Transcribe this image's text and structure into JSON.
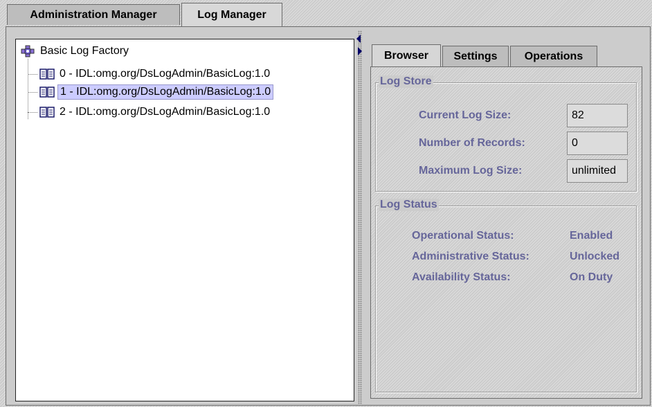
{
  "top_tabs": [
    {
      "label": "Administration Manager",
      "active": false
    },
    {
      "label": "Log Manager",
      "active": true
    }
  ],
  "tree": {
    "root": {
      "label": "Basic Log Factory",
      "icon": "log-factory-icon"
    },
    "items": [
      {
        "label": "0 - IDL:omg.org/DsLogAdmin/BasicLog:1.0",
        "icon": "book-icon",
        "selected": false
      },
      {
        "label": "1 - IDL:omg.org/DsLogAdmin/BasicLog:1.0",
        "icon": "book-icon",
        "selected": true
      },
      {
        "label": "2 - IDL:omg.org/DsLogAdmin/BasicLog:1.0",
        "icon": "book-icon",
        "selected": false
      }
    ]
  },
  "sub_tabs": [
    {
      "label": "Browser",
      "active": true
    },
    {
      "label": "Settings",
      "active": false
    },
    {
      "label": "Operations",
      "active": false
    }
  ],
  "log_store": {
    "title": "Log Store",
    "current_log_size_label": "Current Log Size:",
    "current_log_size_value": "82",
    "number_of_records_label": "Number of Records:",
    "number_of_records_value": "0",
    "maximum_log_size_label": "Maximum Log Size:",
    "maximum_log_size_value": "unlimited"
  },
  "log_status": {
    "title": "Log Status",
    "operational_label": "Operational Status:",
    "operational_value": "Enabled",
    "administrative_label": "Administrative Status:",
    "administrative_value": "Unlocked",
    "availability_label": "Availability Status:",
    "availability_value": "On Duty"
  },
  "colors": {
    "label_blue": "#66669a",
    "selection": "#ccccff",
    "background": "#cccccc"
  }
}
